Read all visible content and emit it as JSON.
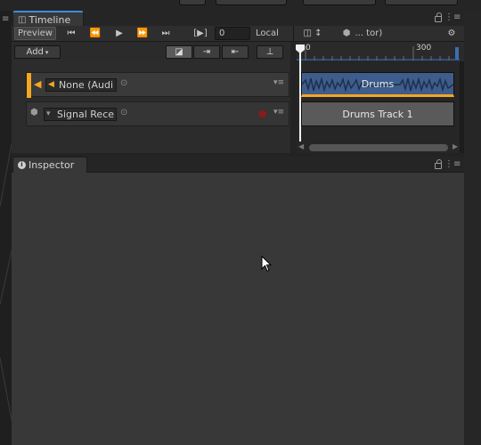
{
  "timeline": {
    "tab_label": "Timeline",
    "preview_label": "Preview",
    "frame_value": "0",
    "time_mode": "Local",
    "director_label": "... tor)",
    "add_label": "Add",
    "ruler_label_0": "0",
    "ruler_label_300": "300",
    "tracks": [
      {
        "name": "None (Audi",
        "clip": "Drums",
        "color": "#f5a623"
      },
      {
        "name": "Signal Rece",
        "clip": "Drums Track 1",
        "color": "#7a7a7a"
      }
    ]
  },
  "inspector": {
    "tab_label": "Inspector"
  },
  "colors": {
    "accent": "#3c8ed8",
    "audio_track": "#f5a623",
    "audio_clip": "#4c6fa0",
    "signal_marker": "#8b1a1a"
  }
}
